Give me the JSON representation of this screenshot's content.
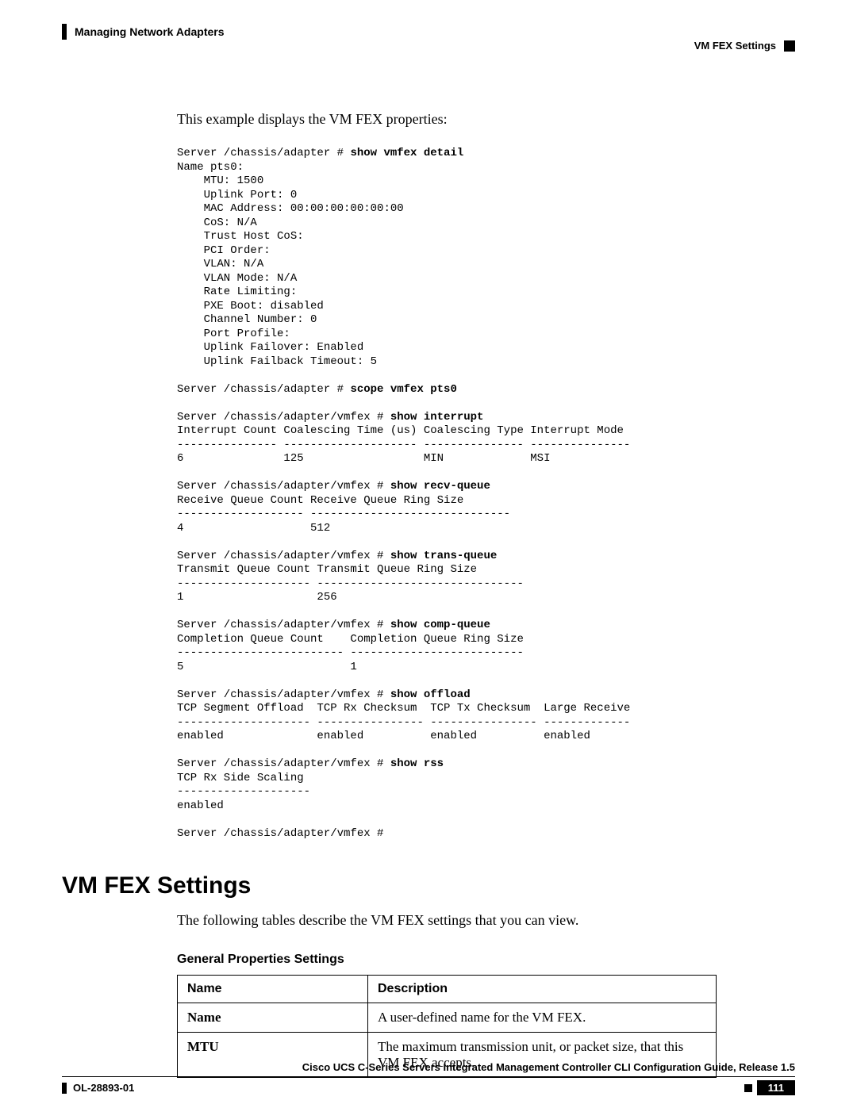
{
  "header": {
    "left": "Managing Network Adapters",
    "right": "VM FEX Settings"
  },
  "intro": "This example displays the VM FEX properties:",
  "code": {
    "lines": [
      {
        "t": "Server /chassis/adapter # ",
        "b": "show vmfex detail"
      },
      {
        "t": "Name pts0:"
      },
      {
        "t": "    MTU: 1500"
      },
      {
        "t": "    Uplink Port: 0"
      },
      {
        "t": "    MAC Address: 00:00:00:00:00:00"
      },
      {
        "t": "    CoS: N/A"
      },
      {
        "t": "    Trust Host CoS:"
      },
      {
        "t": "    PCI Order:"
      },
      {
        "t": "    VLAN: N/A"
      },
      {
        "t": "    VLAN Mode: N/A"
      },
      {
        "t": "    Rate Limiting:"
      },
      {
        "t": "    PXE Boot: disabled"
      },
      {
        "t": "    Channel Number: 0"
      },
      {
        "t": "    Port Profile:"
      },
      {
        "t": "    Uplink Failover: Enabled"
      },
      {
        "t": "    Uplink Failback Timeout: 5"
      },
      {
        "t": ""
      },
      {
        "t": "Server /chassis/adapter # ",
        "b": "scope vmfex pts0"
      },
      {
        "t": ""
      },
      {
        "t": "Server /chassis/adapter/vmfex # ",
        "b": "show interrupt"
      },
      {
        "t": "Interrupt Count Coalescing Time (us) Coalescing Type Interrupt Mode"
      },
      {
        "t": "--------------- -------------------- --------------- ---------------"
      },
      {
        "t": "6               125                  MIN             MSI"
      },
      {
        "t": ""
      },
      {
        "t": "Server /chassis/adapter/vmfex # ",
        "b": "show recv-queue"
      },
      {
        "t": "Receive Queue Count Receive Queue Ring Size"
      },
      {
        "t": "------------------- ------------------------------"
      },
      {
        "t": "4                   512"
      },
      {
        "t": ""
      },
      {
        "t": "Server /chassis/adapter/vmfex # ",
        "b": "show trans-queue"
      },
      {
        "t": "Transmit Queue Count Transmit Queue Ring Size"
      },
      {
        "t": "-------------------- -------------------------------"
      },
      {
        "t": "1                    256"
      },
      {
        "t": ""
      },
      {
        "t": "Server /chassis/adapter/vmfex # ",
        "b": "show comp-queue"
      },
      {
        "t": "Completion Queue Count    Completion Queue Ring Size"
      },
      {
        "t": "------------------------- --------------------------"
      },
      {
        "t": "5                         1"
      },
      {
        "t": ""
      },
      {
        "t": "Server /chassis/adapter/vmfex # ",
        "b": "show offload"
      },
      {
        "t": "TCP Segment Offload  TCP Rx Checksum  TCP Tx Checksum  Large Receive"
      },
      {
        "t": "-------------------- ---------------- ---------------- -------------"
      },
      {
        "t": "enabled              enabled          enabled          enabled"
      },
      {
        "t": ""
      },
      {
        "t": "Server /chassis/adapter/vmfex # ",
        "b": "show rss"
      },
      {
        "t": "TCP Rx Side Scaling"
      },
      {
        "t": "--------------------"
      },
      {
        "t": "enabled"
      },
      {
        "t": ""
      },
      {
        "t": "Server /chassis/adapter/vmfex #"
      }
    ]
  },
  "section": {
    "heading": "VM FEX Settings",
    "intro": "The following tables describe the VM FEX settings that you can view.",
    "subheading": "General Properties Settings"
  },
  "table": {
    "headers": [
      "Name",
      "Description"
    ],
    "rows": [
      {
        "name": "Name",
        "desc": "A user-defined name for the VM FEX."
      },
      {
        "name": "MTU",
        "desc": "The maximum transmission unit, or packet size, that this VM FEX accepts."
      }
    ]
  },
  "footer": {
    "title": "Cisco UCS C-Series Servers Integrated Management Controller CLI Configuration Guide, Release 1.5",
    "left": "OL-28893-01",
    "page": "111"
  }
}
